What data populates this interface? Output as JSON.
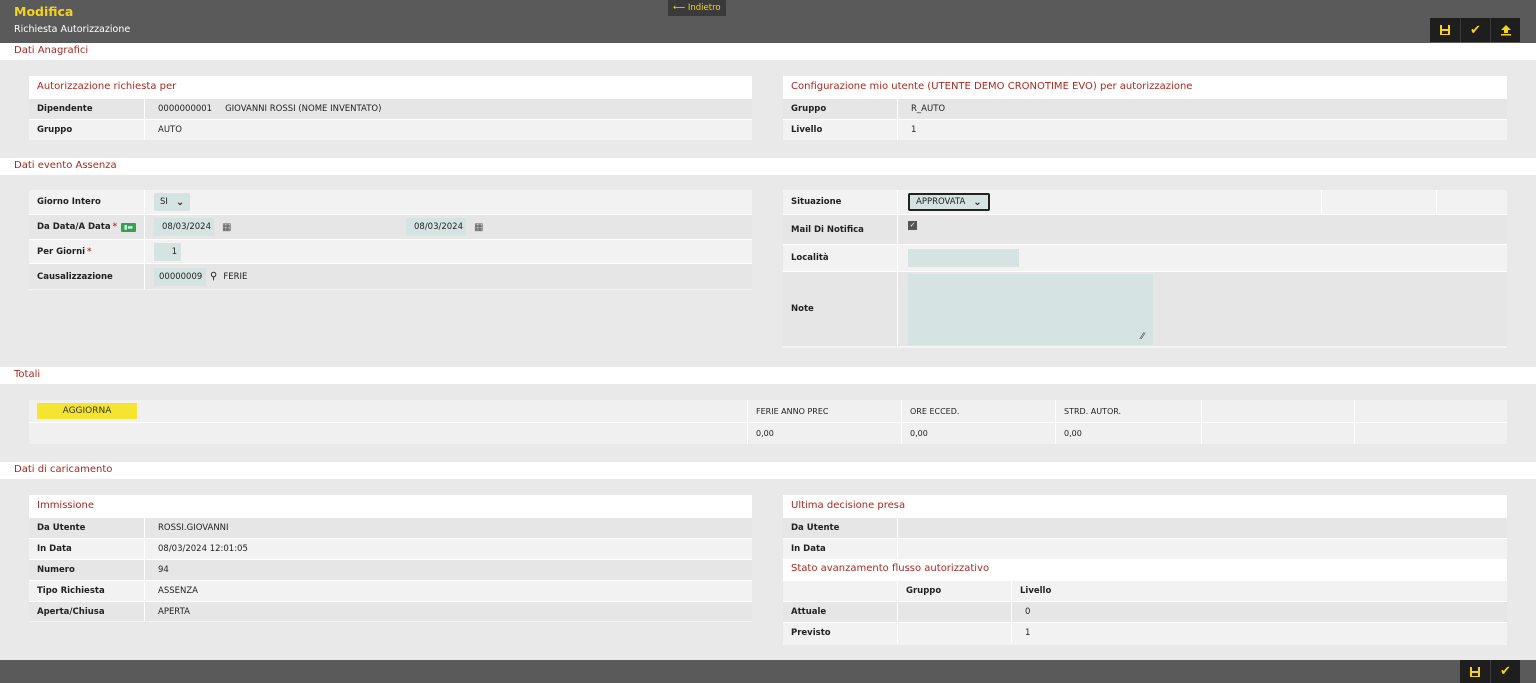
{
  "header": {
    "title": "Modifica",
    "subtitle": "Richiesta Autorizzazione",
    "back_label": "⟵ Indietro",
    "icons": [
      "save-icon",
      "check-icon",
      "upload-icon"
    ]
  },
  "sections": {
    "anagrafici": "Dati Anagrafici",
    "evento": "Dati evento Assenza",
    "totali": "Totali",
    "caricamento": "Dati di caricamento"
  },
  "autorizzazione": {
    "title": "Autorizzazione richiesta per",
    "dipendente_label": "Dipendente",
    "dipendente_code": "0000000001",
    "dipendente_name": "GIOVANNI ROSSI (NOME INVENTATO)",
    "gruppo_label": "Gruppo",
    "gruppo_value": "AUTO"
  },
  "configurazione": {
    "title": "Configurazione mio utente (UTENTE DEMO CRONOTIME EVO) per autorizzazione",
    "gruppo_label": "Gruppo",
    "gruppo_value": "R_AUTO",
    "livello_label": "Livello",
    "livello_value": "1"
  },
  "evento": {
    "giorno_intero_label": "Giorno Intero",
    "giorno_intero_value": "SI",
    "data_label": "Da Data/A Data",
    "data_from": "08/03/2024",
    "data_to": "08/03/2024",
    "per_giorni_label": "Per Giorni",
    "per_giorni_value": "1",
    "causale_label": "Causalizzazione",
    "causale_code": "00000009",
    "causale_desc": "FERIE",
    "required_mark": "*",
    "situazione_label": "Situazione",
    "situazione_value": "APPROVATA",
    "mail_label": "Mail Di Notifica",
    "mail_checked": true,
    "localita_label": "Località",
    "note_label": "Note"
  },
  "totali": {
    "button": "AGGIORNA",
    "headers": [
      "FERIE ANNO PREC",
      "ORE ECCED.",
      "STRD. AUTOR."
    ],
    "values": [
      "0,00",
      "0,00",
      "0,00"
    ]
  },
  "immissione": {
    "title": "Immissione",
    "rows": [
      {
        "label": "Da Utente",
        "value": "ROSSI.GIOVANNI"
      },
      {
        "label": "In Data",
        "value": "08/03/2024 12:01:05"
      },
      {
        "label": "Numero",
        "value": "94"
      },
      {
        "label": "Tipo Richiesta",
        "value": "ASSENZA"
      },
      {
        "label": "Aperta/Chiusa",
        "value": "APERTA"
      }
    ]
  },
  "decisione": {
    "title": "Ultima decisione presa",
    "da_utente_label": "Da Utente",
    "in_data_label": "In Data",
    "flusso_title": "Stato avanzamento flusso autorizzativo",
    "col_gruppo": "Gruppo",
    "col_livello": "Livello",
    "attuale_label": "Attuale",
    "attuale_livello": "0",
    "previsto_label": "Previsto",
    "previsto_livello": "1"
  },
  "footer": {
    "icons": [
      "save-icon",
      "check-icon"
    ]
  }
}
